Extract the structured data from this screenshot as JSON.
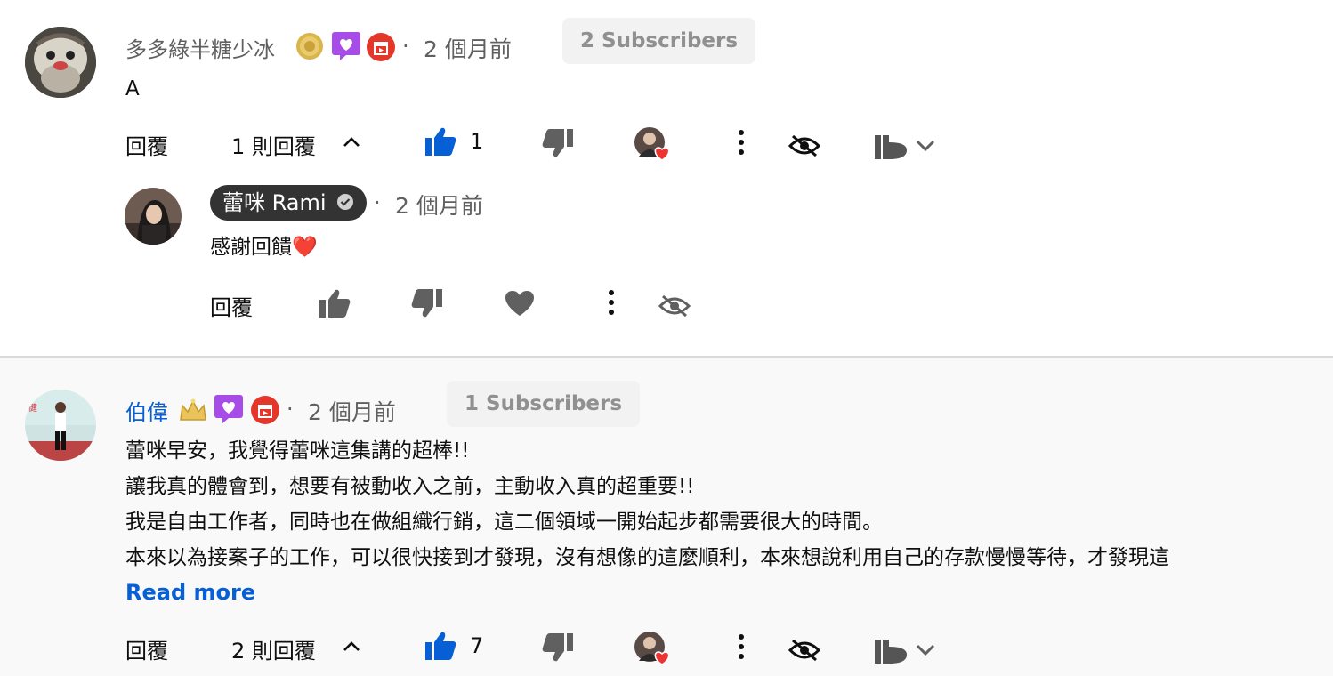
{
  "comments": [
    {
      "author": "多多綠半糖少冰",
      "time": "2 個月前",
      "subscribers": "2 Subscribers",
      "text": "A",
      "reply_label": "回覆",
      "replies_toggle": "1 則回覆",
      "like_count": "1",
      "reply": {
        "author": "蕾咪 Rami",
        "time": "2 個月前",
        "text": "感謝回饋❤️",
        "reply_label": "回覆"
      }
    },
    {
      "author": "伯偉",
      "time": "2 個月前",
      "subscribers": "1 Subscribers",
      "lines": [
        "蕾咪早安，我覺得蕾咪這集講的超棒!!",
        "讓我真的體會到，想要有被動收入之前，主動收入真的超重要!!",
        "我是自由工作者，同時也在做組織行銷，這二個領域一開始起步都需要很大的時間。",
        "本來以為接案子的工作，可以很快接到才發現，沒有想像的這麼順利，本來想說利用自己的存款慢慢等待，才發現這"
      ],
      "read_more": "Read more",
      "reply_label": "回覆",
      "replies_toggle": "2 則回覆",
      "like_count": "7"
    }
  ],
  "separator": "·",
  "colors": {
    "link_blue": "#065fd4",
    "like_blue": "#065fd4",
    "heart_red": "#e33",
    "member_purple": "#a74ce6",
    "badge_red": "#e5362b"
  }
}
